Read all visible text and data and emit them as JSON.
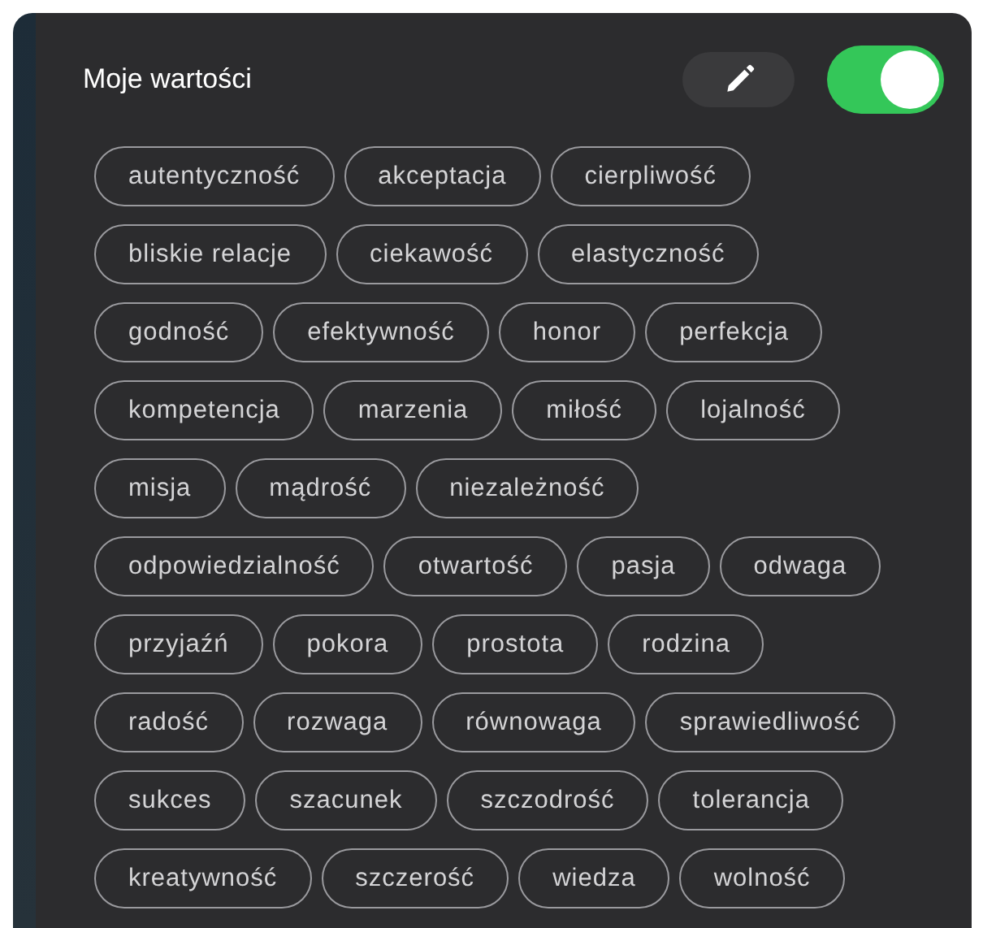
{
  "header": {
    "title": "Moje wartości",
    "toggle": {
      "on": true
    }
  },
  "value_rows": [
    [
      "autentyczność",
      "akceptacja",
      "cierpliwość"
    ],
    [
      "bliskie relacje",
      "ciekawość",
      "elastyczność"
    ],
    [
      "godność",
      "efektywność",
      "honor",
      "perfekcja"
    ],
    [
      "kompetencja",
      "marzenia",
      "miłość",
      "lojalność"
    ],
    [
      "misja",
      "mądrość",
      "niezależność"
    ],
    [
      "odpowiedzialność",
      "otwartość",
      "pasja",
      "odwaga"
    ],
    [
      "przyjaźń",
      "pokora",
      "prostota",
      "rodzina"
    ],
    [
      "radość",
      "rozwaga",
      "równowaga",
      "sprawiedliwość"
    ],
    [
      "sukces",
      "szacunek",
      "szczodrość",
      "tolerancja"
    ],
    [
      "kreatywność",
      "szczerość",
      "wiedza",
      "wolność"
    ]
  ]
}
